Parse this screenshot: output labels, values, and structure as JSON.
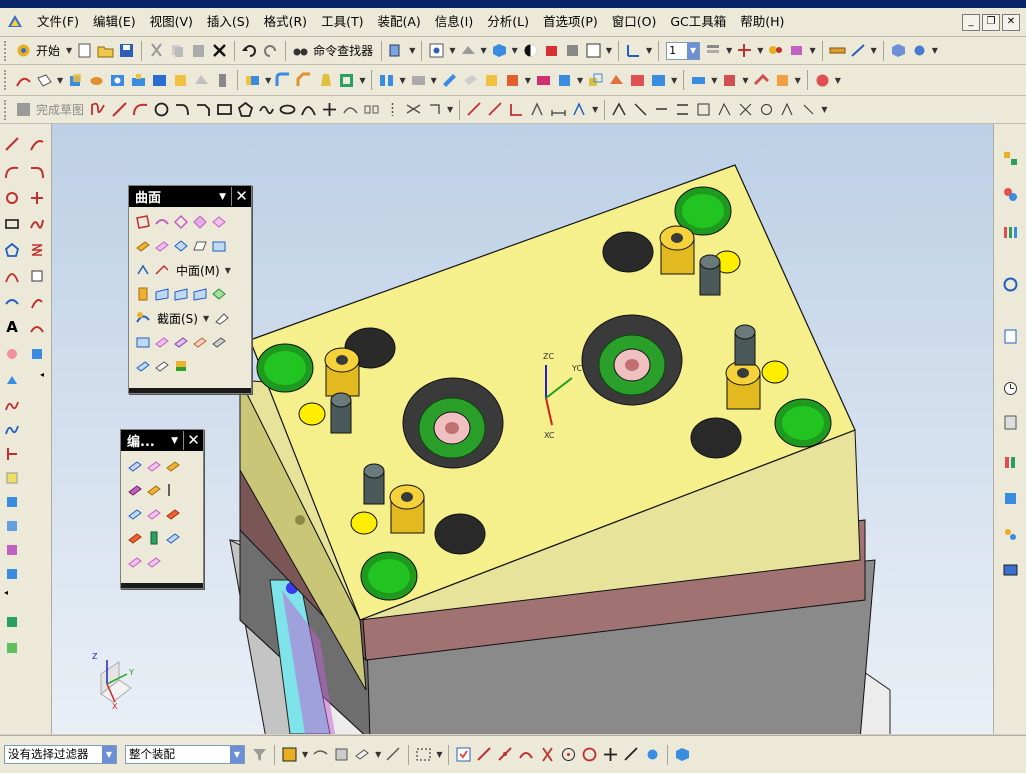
{
  "menubar": {
    "items": [
      "文件(F)",
      "编辑(E)",
      "视图(V)",
      "插入(S)",
      "格式(R)",
      "工具(T)",
      "装配(A)",
      "信息(I)",
      "分析(L)",
      "首选项(P)",
      "窗口(O)",
      "GC工具箱",
      "帮助(H)"
    ],
    "window_controls": [
      "_",
      "❐",
      "✕"
    ]
  },
  "toolbar1": {
    "start_label": "开始",
    "command_finder_label": "命令查找器",
    "layer_value": "1"
  },
  "toolbar3": {
    "finish_sketch_label": "完成草图"
  },
  "surface_palette": {
    "title": "曲面",
    "mid_surface_label": "中面(M)",
    "section_label": "截面(S)"
  },
  "edit_palette": {
    "title": "编..."
  },
  "statusbar": {
    "filter_value": "没有选择过滤器",
    "scope_value": "整个装配"
  },
  "viewport": {
    "csys_labels": {
      "zc": "ZC",
      "yc": "YC",
      "xc": "XC"
    },
    "triad_labels": {
      "z": "Z",
      "y": "Y",
      "x": "X"
    }
  },
  "colors": {
    "plate_top": "#f5f08c",
    "plate_side": "#e7e39a",
    "pink_layer": "#a07272",
    "gray_body": "#8a8a8a",
    "green_bushing": "#22c422",
    "gear_green": "#2aa02a",
    "gold_pin": "#e2ba20",
    "viewport_bg_top": "#bdd0e6",
    "viewport_bg_bottom": "#eaeff6"
  }
}
